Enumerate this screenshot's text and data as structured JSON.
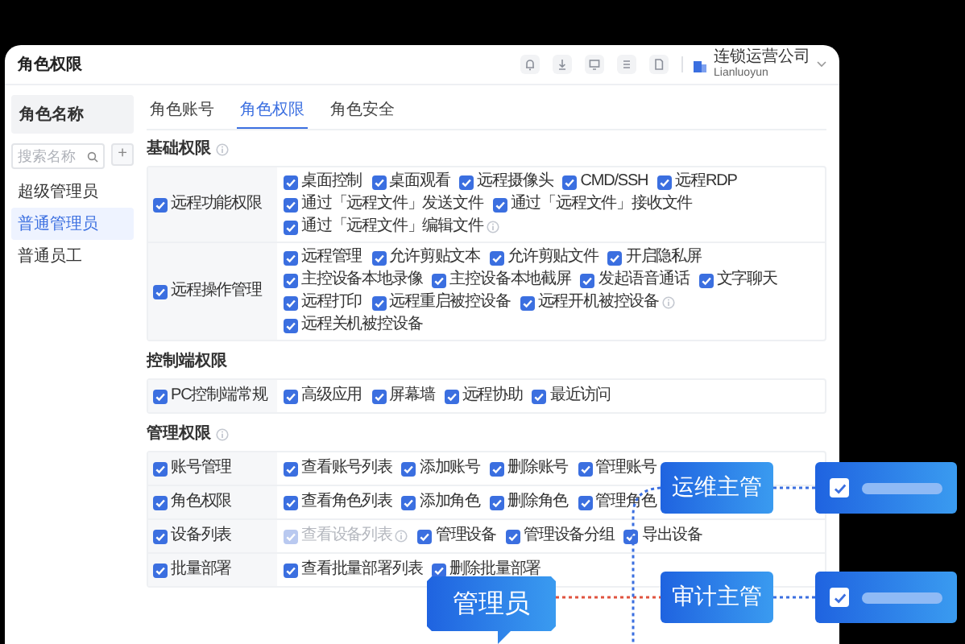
{
  "window": {
    "title": "角色权限"
  },
  "account": {
    "company": "连锁运营公司",
    "user": "Lianluoyun"
  },
  "sidebar": {
    "header": "角色名称",
    "search": {
      "placeholder": "搜索名称"
    },
    "add_button": "+",
    "roles": [
      {
        "label": "超级管理员",
        "selected": false
      },
      {
        "label": "普通管理员",
        "selected": true
      },
      {
        "label": "普通员工",
        "selected": false
      }
    ]
  },
  "tabs": [
    {
      "label": "角色账号",
      "selected": false
    },
    {
      "label": "角色权限",
      "selected": true
    },
    {
      "label": "角色安全",
      "selected": false
    }
  ],
  "sections": [
    {
      "title": "基础权限",
      "info": true,
      "groups": [
        {
          "label": "远程功能权限",
          "checked": true,
          "items": [
            {
              "label": "桌面控制",
              "checked": true,
              "disabled": false,
              "info": false
            },
            {
              "label": "桌面观看",
              "checked": true,
              "disabled": false,
              "info": false
            },
            {
              "label": "远程摄像头",
              "checked": true,
              "disabled": false,
              "info": false
            },
            {
              "label": "CMD/SSH",
              "checked": true,
              "disabled": false,
              "info": false
            },
            {
              "label": "远程RDP",
              "checked": true,
              "disabled": false,
              "info": false
            },
            {
              "label": "通过「远程文件」发送文件",
              "checked": true,
              "disabled": false,
              "info": false
            },
            {
              "label": "通过「远程文件」接收文件",
              "checked": true,
              "disabled": false,
              "info": false
            },
            {
              "label": "通过「远程文件」编辑文件",
              "checked": true,
              "disabled": false,
              "info": true
            }
          ]
        },
        {
          "label": "远程操作管理",
          "checked": true,
          "items": [
            {
              "label": "远程管理",
              "checked": true,
              "disabled": false,
              "info": false
            },
            {
              "label": "允许剪贴文本",
              "checked": true,
              "disabled": false,
              "info": false
            },
            {
              "label": "允许剪贴文件",
              "checked": true,
              "disabled": false,
              "info": false
            },
            {
              "label": "开启隐私屏",
              "checked": true,
              "disabled": false,
              "info": false
            },
            {
              "label": "主控设备本地录像",
              "checked": true,
              "disabled": false,
              "info": false
            },
            {
              "label": "主控设备本地截屏",
              "checked": true,
              "disabled": false,
              "info": false
            },
            {
              "label": "发起语音通话",
              "checked": true,
              "disabled": false,
              "info": false
            },
            {
              "label": "文字聊天",
              "checked": true,
              "disabled": false,
              "info": false
            },
            {
              "label": "远程打印",
              "checked": true,
              "disabled": false,
              "info": false
            },
            {
              "label": "远程重启被控设备",
              "checked": true,
              "disabled": false,
              "info": false
            },
            {
              "label": "远程开机被控设备",
              "checked": true,
              "disabled": false,
              "info": true
            },
            {
              "label": "远程关机被控设备",
              "checked": true,
              "disabled": false,
              "info": false
            }
          ]
        }
      ]
    },
    {
      "title": "控制端权限",
      "info": false,
      "groups": [
        {
          "label": "PC控制端常规",
          "checked": true,
          "items": [
            {
              "label": "高级应用",
              "checked": true,
              "disabled": false,
              "info": false
            },
            {
              "label": "屏幕墙",
              "checked": true,
              "disabled": false,
              "info": false
            },
            {
              "label": "远程协助",
              "checked": true,
              "disabled": false,
              "info": false
            },
            {
              "label": "最近访问",
              "checked": true,
              "disabled": false,
              "info": false
            }
          ]
        }
      ]
    },
    {
      "title": "管理权限",
      "info": true,
      "groups": [
        {
          "label": "账号管理",
          "checked": true,
          "items": [
            {
              "label": "查看账号列表",
              "checked": true,
              "disabled": false,
              "info": false
            },
            {
              "label": "添加账号",
              "checked": true,
              "disabled": false,
              "info": false
            },
            {
              "label": "删除账号",
              "checked": true,
              "disabled": false,
              "info": false
            },
            {
              "label": "管理账号",
              "checked": true,
              "disabled": false,
              "info": false
            }
          ]
        },
        {
          "label": "角色权限",
          "checked": true,
          "items": [
            {
              "label": "查看角色列表",
              "checked": true,
              "disabled": false,
              "info": false
            },
            {
              "label": "添加角色",
              "checked": true,
              "disabled": false,
              "info": false
            },
            {
              "label": "删除角色",
              "checked": true,
              "disabled": false,
              "info": false
            },
            {
              "label": "管理角色",
              "checked": true,
              "disabled": false,
              "info": false
            }
          ]
        },
        {
          "label": "设备列表",
          "checked": true,
          "items": [
            {
              "label": "查看设备列表",
              "checked": true,
              "disabled": true,
              "info": true
            },
            {
              "label": "管理设备",
              "checked": true,
              "disabled": false,
              "info": false
            },
            {
              "label": "管理设备分组",
              "checked": true,
              "disabled": false,
              "info": false
            },
            {
              "label": "导出设备",
              "checked": true,
              "disabled": false,
              "info": false
            }
          ]
        },
        {
          "label": "批量部署",
          "checked": true,
          "items": [
            {
              "label": "查看批量部署列表",
              "checked": true,
              "disabled": false,
              "info": false
            },
            {
              "label": "删除批量部署",
              "checked": true,
              "disabled": false,
              "info": false
            }
          ]
        }
      ]
    }
  ],
  "diagram": {
    "admin": "管理员",
    "roles": [
      {
        "label": "运维主管",
        "checked": true
      },
      {
        "label": "审计主管",
        "checked": true
      }
    ]
  }
}
